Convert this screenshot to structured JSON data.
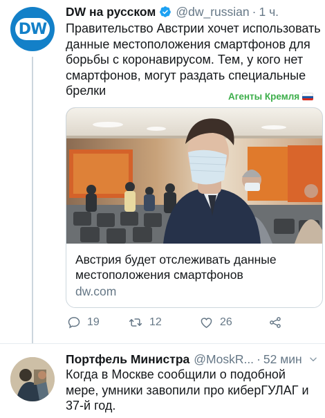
{
  "tweet1": {
    "name": "DW на русском",
    "handle": "@dw_russian",
    "time": "1 ч.",
    "text": "Правительство Австрии хочет использовать данные местоположения смартфонов для борьбы с коронавирусом. Тем, у кого нет смартфонов, могут раздать специальные брелки",
    "tag": "Агенты Кремля",
    "avatar_label": "DW",
    "card": {
      "title": "Австрия будет отслеживать данные местоположения смартфонов",
      "domain": "dw.com"
    },
    "actions": {
      "reply_count": "19",
      "retweet_count": "12",
      "like_count": "26"
    }
  },
  "tweet2": {
    "name": "Портфель Министра",
    "handle": "@MoskR...",
    "time": "52 мин",
    "text": "Когда в Москве сообщили о подобной мере, умники завопили про киберГУЛАГ и 37-й год."
  },
  "colors": {
    "link_blue": "#1da1f2",
    "muted": "#657786",
    "tag_green": "#3cae4a",
    "dw_blue": "#1380c8"
  },
  "icons": [
    "dw-logo",
    "verified-badge-icon",
    "chevron-down-icon",
    "russian-flag-icon",
    "reply-icon",
    "retweet-icon",
    "like-icon",
    "share-icon"
  ]
}
